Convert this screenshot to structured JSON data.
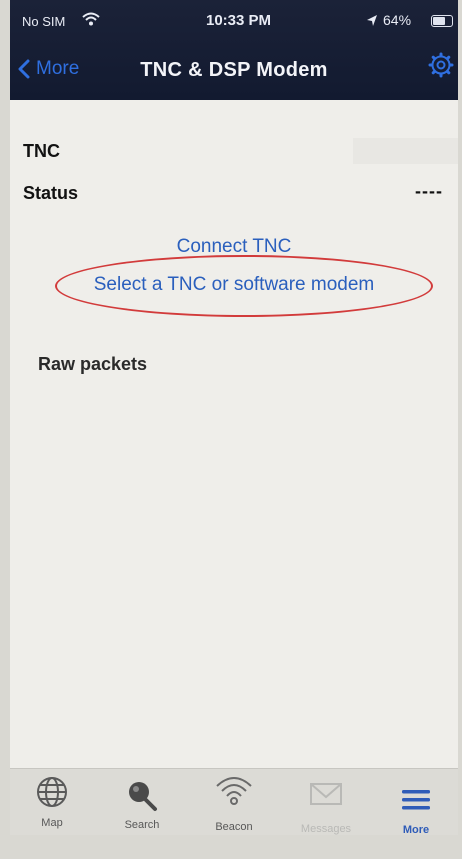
{
  "status_bar": {
    "carrier": "No SIM",
    "time": "10:33 PM",
    "battery": "64%"
  },
  "nav": {
    "back_label": "More",
    "title": "TNC & DSP Modem"
  },
  "content": {
    "tnc_label": "TNC",
    "status_label": "Status",
    "status_value": "----",
    "connect_tnc": "Connect TNC",
    "select_tnc": "Select a TNC or software modem",
    "raw_packets": "Raw packets"
  },
  "tabs": [
    {
      "label": "Map",
      "icon": "globe-icon"
    },
    {
      "label": "Search",
      "icon": "magnifier-icon"
    },
    {
      "label": "Beacon",
      "icon": "broadcast-icon"
    },
    {
      "label": "Messages",
      "icon": "envelope-icon"
    },
    {
      "label": "More",
      "icon": "menu-lines-icon"
    }
  ],
  "colors": {
    "accent": "#2a5fbd",
    "nav_bg": "#1b2238",
    "highlight_ellipse": "#d23b3b"
  }
}
